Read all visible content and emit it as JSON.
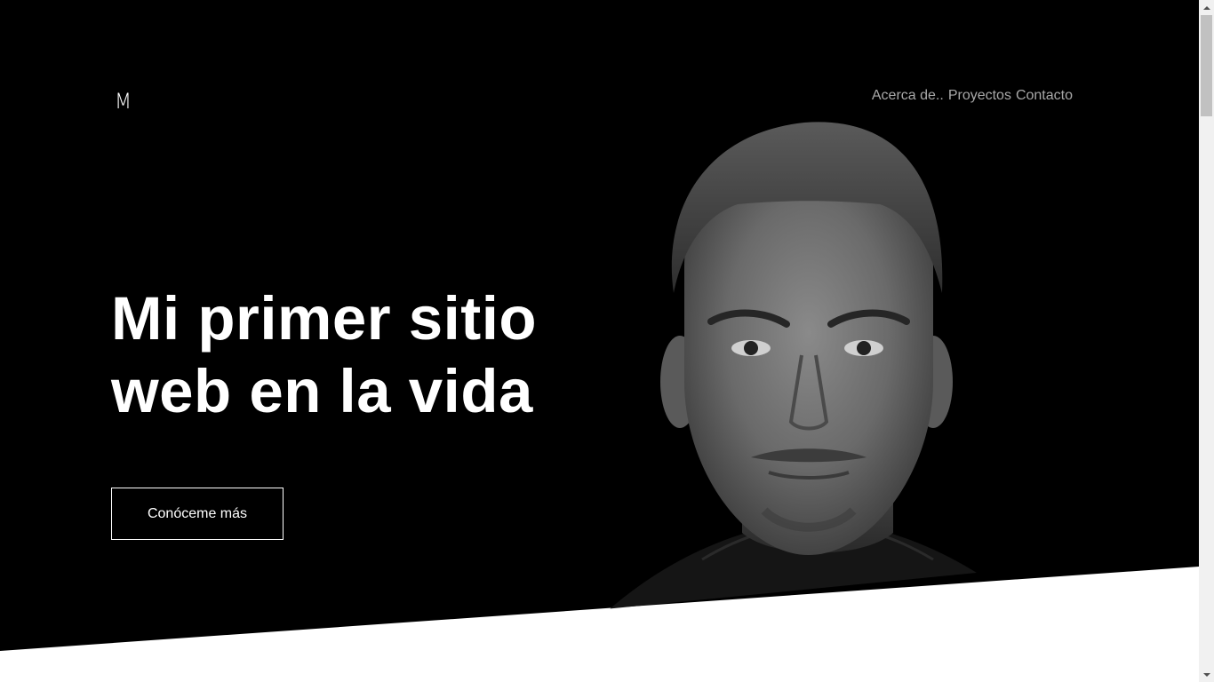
{
  "brand": {
    "logo_text": "M"
  },
  "nav": {
    "items": [
      {
        "label": "Acerca de.."
      },
      {
        "label": "Proyectos"
      },
      {
        "label": "Contacto"
      }
    ]
  },
  "hero": {
    "headline_line1": "Mi primer sitio",
    "headline_line2": "web en la vida",
    "cta_label": "Conóceme más",
    "portrait_icon": "portrait-photo"
  },
  "colors": {
    "background": "#000000",
    "text": "#ffffff",
    "nav_text": "#a8a8a8",
    "lower_section": "#ffffff"
  }
}
